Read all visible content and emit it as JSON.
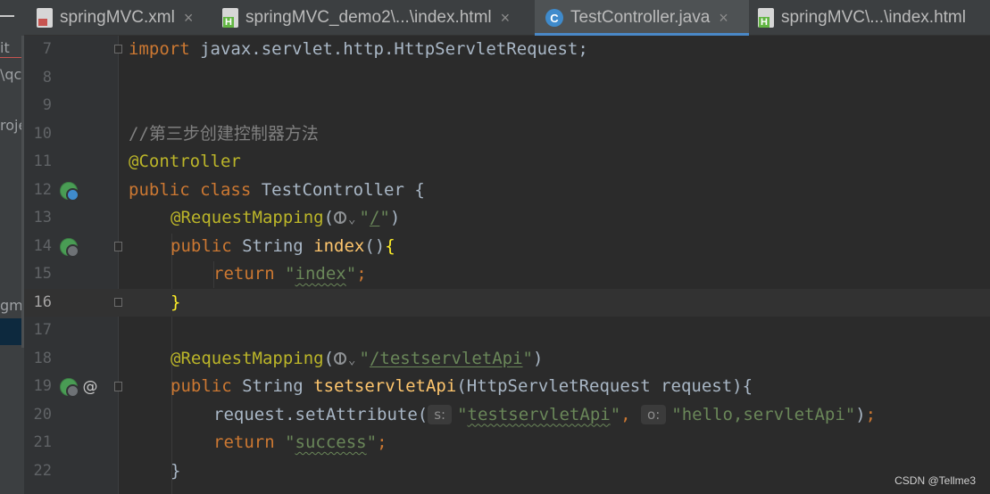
{
  "left_panel": {
    "fragments": [
      "it",
      "\\qc",
      "roje",
      "gm"
    ]
  },
  "tabs": [
    {
      "label": "springMVC.xml",
      "icon": "xml-file-icon",
      "closable": true,
      "active": false
    },
    {
      "label": "springMVC_demo2\\...\\index.html",
      "icon": "html-file-icon",
      "closable": true,
      "active": false
    },
    {
      "label": "TestController.java",
      "icon": "java-class-icon",
      "closable": true,
      "active": true
    },
    {
      "label": "springMVC\\...\\index.html",
      "icon": "html-file-icon",
      "closable": false,
      "active": false
    }
  ],
  "class_icon_letter": "C",
  "close_glyph": "×",
  "editor": {
    "current_line": 16,
    "lines": [
      {
        "n": "7",
        "text": "import javax.servlet.http.HttpServletRequest;"
      },
      {
        "n": "8",
        "text": ""
      },
      {
        "n": "9",
        "text": ""
      },
      {
        "n": "10",
        "text": "//第三步创建控制器方法"
      },
      {
        "n": "11",
        "text": "@Controller"
      },
      {
        "n": "12",
        "text": "public class TestController {"
      },
      {
        "n": "13",
        "text": "@RequestMapping(\"/\")"
      },
      {
        "n": "14",
        "text": "public String index(){"
      },
      {
        "n": "15",
        "text": "return \"index\";"
      },
      {
        "n": "16",
        "text": "}"
      },
      {
        "n": "17",
        "text": ""
      },
      {
        "n": "18",
        "text": "@RequestMapping(\"/testservletApi\")"
      },
      {
        "n": "19",
        "text": "public String tsetservletApi(HttpServletRequest request){"
      },
      {
        "n": "20",
        "text": "request.setAttribute(\"testservletApi\",\"hello,servletApi\");"
      },
      {
        "n": "21",
        "text": "return \"success\";"
      },
      {
        "n": "22",
        "text": "}"
      }
    ],
    "tokens": {
      "import_kw": "import",
      "import_path": " javax.servlet.http.HttpServletRequest;",
      "comment": "//第三步创建控制器方法",
      "controller_ann": "@Controller",
      "public_kw": "public",
      "class_kw": "class",
      "class_name": " TestController {",
      "request_mapping": "@RequestMapping",
      "root_path": "/",
      "string_type": " String ",
      "index_fn": "index",
      "return_kw": "return",
      "index_str": "index",
      "test_path": "/testservletApi",
      "tset_fn": "tsetservletApi",
      "param": "(HttpServletRequest request){",
      "set_attr": "request.setAttribute(",
      "hint_s": "s:",
      "hint_o": "o:",
      "attr_name": "testservletApi",
      "attr_value": "hello,servletApi",
      "success_str": "success",
      "chevron": "⌄"
    },
    "gutter_at": "@"
  },
  "watermark": "CSDN @Tellme3"
}
